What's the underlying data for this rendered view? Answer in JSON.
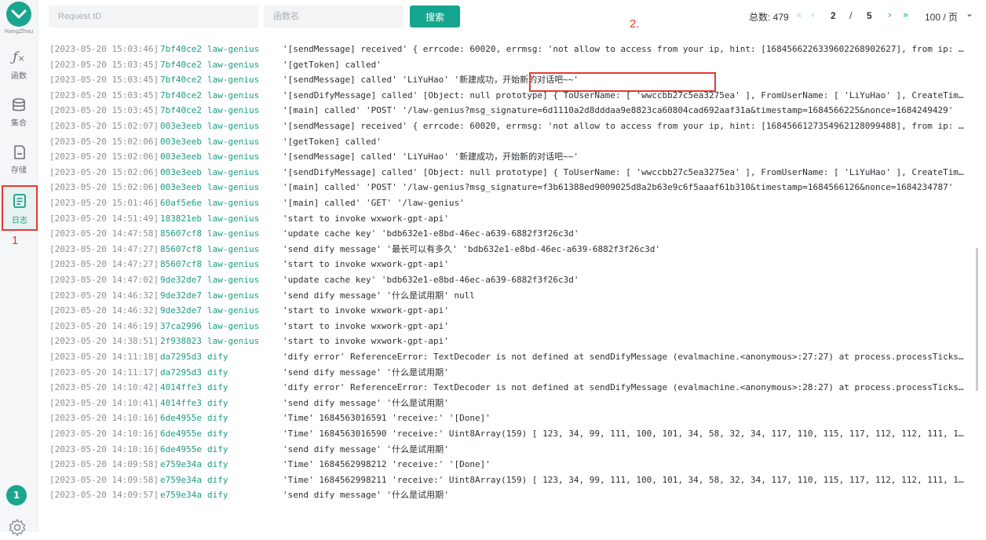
{
  "sidebar": {
    "region": "HangZhou",
    "items": [
      {
        "label": "函数"
      },
      {
        "label": "集合"
      },
      {
        "label": "存储"
      },
      {
        "label": "日志"
      }
    ],
    "user_badge": "1"
  },
  "annotations": {
    "one": "1",
    "two": "2."
  },
  "search": {
    "request_id_placeholder": "Request ID",
    "function_placeholder": "函数名",
    "search_label": "搜索"
  },
  "pagination": {
    "total": "总数: 479",
    "current": "2",
    "sep": "/",
    "pages": "5",
    "page_size": "100 / 页"
  },
  "log": {
    "rows": [
      {
        "t": "[2023-05-20 15:03:46]",
        "id": "7bf40ce2",
        "fn": "law-genius",
        "msg": "'[sendMessage] received' { errcode: 60020, errmsg: 'not allow to access from your ip, hint: [1684566226339602268902627], from ip: 112.…"
      },
      {
        "t": "[2023-05-20 15:03:45]",
        "id": "7bf40ce2",
        "fn": "law-genius",
        "msg": "'[getToken] called'"
      },
      {
        "t": "[2023-05-20 15:03:45]",
        "id": "7bf40ce2",
        "fn": "law-genius",
        "msg": "'[sendMessage] called' 'LiYuHao' '新建成功，开始新的对话吧~~'"
      },
      {
        "t": "[2023-05-20 15:03:45]",
        "id": "7bf40ce2",
        "fn": "law-genius",
        "msg": "'[sendDifyMessage] called' [Object: null prototype] { ToUserName: [ 'wwccbb27c5ea3275ea' ], FromUserName: [ 'LiYuHao' ], CreateTime: […"
      },
      {
        "t": "[2023-05-20 15:03:45]",
        "id": "7bf40ce2",
        "fn": "law-genius",
        "msg": "'[main] called' 'POST' '/law-genius?msg_signature=6d1110a2d8dddaa9e8823ca60804cad692aaf31a&timestamp=1684566225&nonce=1684249429'"
      },
      {
        "t": "[2023-05-20 15:02:07]",
        "id": "003e3eeb",
        "fn": "law-genius",
        "msg": "'[sendMessage] received' { errcode: 60020, errmsg: 'not allow to access from your ip, hint: [1684566127354962128099488], from ip: 112.…"
      },
      {
        "t": "[2023-05-20 15:02:06]",
        "id": "003e3eeb",
        "fn": "law-genius",
        "msg": "'[getToken] called'"
      },
      {
        "t": "[2023-05-20 15:02:06]",
        "id": "003e3eeb",
        "fn": "law-genius",
        "msg": "'[sendMessage] called' 'LiYuHao' '新建成功，开始新的对话吧~~'"
      },
      {
        "t": "[2023-05-20 15:02:06]",
        "id": "003e3eeb",
        "fn": "law-genius",
        "msg": "'[sendDifyMessage] called' [Object: null prototype] { ToUserName: [ 'wwccbb27c5ea3275ea' ], FromUserName: [ 'LiYuHao' ], CreateTime: […"
      },
      {
        "t": "[2023-05-20 15:02:06]",
        "id": "003e3eeb",
        "fn": "law-genius",
        "msg": "'[main] called' 'POST' '/law-genius?msg_signature=f3b61388ed9009025d8a2b63e9c6f5aaaf61b310&timestamp=1684566126&nonce=1684234787'"
      },
      {
        "t": "[2023-05-20 15:01:46]",
        "id": "60af5e6e",
        "fn": "law-genius",
        "msg": "'[main] called' 'GET' '/law-genius'"
      },
      {
        "t": "[2023-05-20 14:51:49]",
        "id": "183821eb",
        "fn": "law-genius",
        "msg": "'start to invoke wxwork-gpt-api'"
      },
      {
        "t": "[2023-05-20 14:47:58]",
        "id": "85607cf8",
        "fn": "law-genius",
        "msg": "'update cache key' 'bdb632e1-e8bd-46ec-a639-6882f3f26c3d'"
      },
      {
        "t": "[2023-05-20 14:47:27]",
        "id": "85607cf8",
        "fn": "law-genius",
        "msg": "'send dify message' '最长可以有多久' 'bdb632e1-e8bd-46ec-a639-6882f3f26c3d'"
      },
      {
        "t": "[2023-05-20 14:47:27]",
        "id": "85607cf8",
        "fn": "law-genius",
        "msg": "'start to invoke wxwork-gpt-api'"
      },
      {
        "t": "[2023-05-20 14:47:02]",
        "id": "9de32de7",
        "fn": "law-genius",
        "msg": "'update cache key' 'bdb632e1-e8bd-46ec-a639-6882f3f26c3d'"
      },
      {
        "t": "[2023-05-20 14:46:32]",
        "id": "9de32de7",
        "fn": "law-genius",
        "msg": "'send dify message' '什么是试用期' null"
      },
      {
        "t": "[2023-05-20 14:46:32]",
        "id": "9de32de7",
        "fn": "law-genius",
        "msg": "'start to invoke wxwork-gpt-api'"
      },
      {
        "t": "[2023-05-20 14:46:19]",
        "id": "37ca2996",
        "fn": "law-genius",
        "msg": "'start to invoke wxwork-gpt-api'"
      },
      {
        "t": "[2023-05-20 14:38:51]",
        "id": "2f938823",
        "fn": "law-genius",
        "msg": "'start to invoke wxwork-gpt-api'"
      },
      {
        "t": "[2023-05-20 14:11:18]",
        "id": "da7295d3",
        "fn": "dify",
        "msg": "'dify error' ReferenceError: TextDecoder is not defined at sendDifyMessage (evalmachine.<anonymous>:27:27) at process.processTicksAndR…"
      },
      {
        "t": "[2023-05-20 14:11:17]",
        "id": "da7295d3",
        "fn": "dify",
        "msg": "'send dify message' '什么是试用期'"
      },
      {
        "t": "[2023-05-20 14:10:42]",
        "id": "4014ffe3",
        "fn": "dify",
        "msg": "'dify error' ReferenceError: TextDecoder is not defined at sendDifyMessage (evalmachine.<anonymous>:28:27) at process.processTicksAndR…"
      },
      {
        "t": "[2023-05-20 14:10:41]",
        "id": "4014ffe3",
        "fn": "dify",
        "msg": "'send dify message' '什么是试用期'"
      },
      {
        "t": "[2023-05-20 14:10:16]",
        "id": "6de4955e",
        "fn": "dify",
        "msg": "'Time' 1684563016591 'receive:' '[Done]'"
      },
      {
        "t": "[2023-05-20 14:10:16]",
        "id": "6de4955e",
        "fn": "dify",
        "msg": "'Time' 1684563016590 'receive:' Uint8Array(159) [ 123, 34, 99, 111, 100, 101, 34, 58, 32, 34, 117, 110, 115, 117, 112, 112, 111, 114, …"
      },
      {
        "t": "[2023-05-20 14:10:16]",
        "id": "6de4955e",
        "fn": "dify",
        "msg": "'send dify message' '什么是试用期'"
      },
      {
        "t": "[2023-05-20 14:09:58]",
        "id": "e759e34a",
        "fn": "dify",
        "msg": "'Time' 1684562998212 'receive:' '[Done]'"
      },
      {
        "t": "[2023-05-20 14:09:58]",
        "id": "e759e34a",
        "fn": "dify",
        "msg": "'Time' 1684562998211 'receive:' Uint8Array(159) [ 123, 34, 99, 111, 100, 101, 34, 58, 32, 34, 117, 110, 115, 117, 112, 112, 111, 114, …"
      },
      {
        "t": "[2023-05-20 14:09:57]",
        "id": "e759e34a",
        "fn": "dify",
        "msg": "'send dify message' '什么是试用期'"
      }
    ]
  }
}
